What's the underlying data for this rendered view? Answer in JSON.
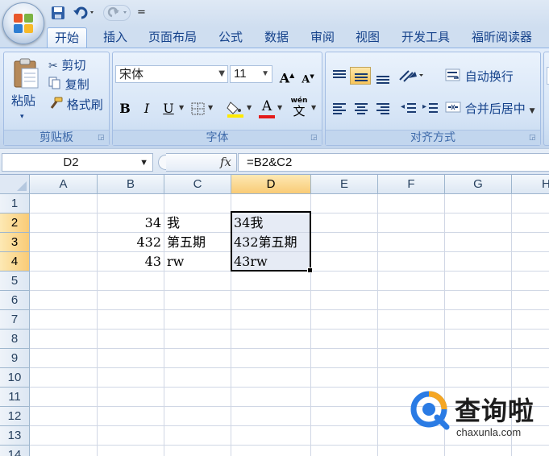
{
  "quick_access": {
    "save": "save-icon",
    "undo": "undo-icon",
    "redo": "redo-icon",
    "customize": "="
  },
  "tabs": [
    {
      "label": "开始",
      "active": true
    },
    {
      "label": "插入"
    },
    {
      "label": "页面布局"
    },
    {
      "label": "公式"
    },
    {
      "label": "数据"
    },
    {
      "label": "审阅"
    },
    {
      "label": "视图"
    },
    {
      "label": "开发工具"
    },
    {
      "label": "福昕阅读器"
    }
  ],
  "ribbon": {
    "clipboard": {
      "paste_label": "粘贴",
      "cut_label": "剪切",
      "copy_label": "复制",
      "format_painter_label": "格式刷",
      "group_label": "剪贴板"
    },
    "font": {
      "font_name": "宋体",
      "font_size": "11",
      "grow": "A",
      "shrink": "A",
      "bold": "B",
      "italic": "I",
      "underline": "U",
      "font_color_letter": "A",
      "phonetic_top": "wén",
      "phonetic_char": "文",
      "group_label": "字体"
    },
    "alignment": {
      "wrap_text_label": "自动换行",
      "merge_center_label": "合并后居中",
      "group_label": "对齐方式"
    }
  },
  "formula_bar": {
    "name_box": "D2",
    "fx": "fx",
    "formula": "=B2&C2"
  },
  "sheet": {
    "columns": [
      "A",
      "B",
      "C",
      "D",
      "E",
      "F",
      "G",
      "H"
    ],
    "rows": [
      "1",
      "2",
      "3",
      "4",
      "5",
      "6",
      "7",
      "8",
      "9",
      "10",
      "11",
      "12",
      "13",
      "14"
    ],
    "selected_column": "D",
    "selected_rows": [
      "2",
      "3",
      "4"
    ],
    "cells": {
      "B2": "34",
      "C2": "我",
      "D2": "34我",
      "B3": "432",
      "C3": "第五期",
      "D3": "432第五期",
      "B4": "43",
      "C4": "rw",
      "D4": "43rw"
    }
  },
  "watermark": {
    "brand": "查询啦",
    "domain": "chaxunla.com"
  },
  "colors": {
    "selection_fill": "#e6ebf5",
    "header_highlight": "#f9cb76",
    "ribbon_blue": "#cfdef0",
    "font_color_bar": "#e31b1b",
    "highlight_bar": "#ffea00"
  }
}
